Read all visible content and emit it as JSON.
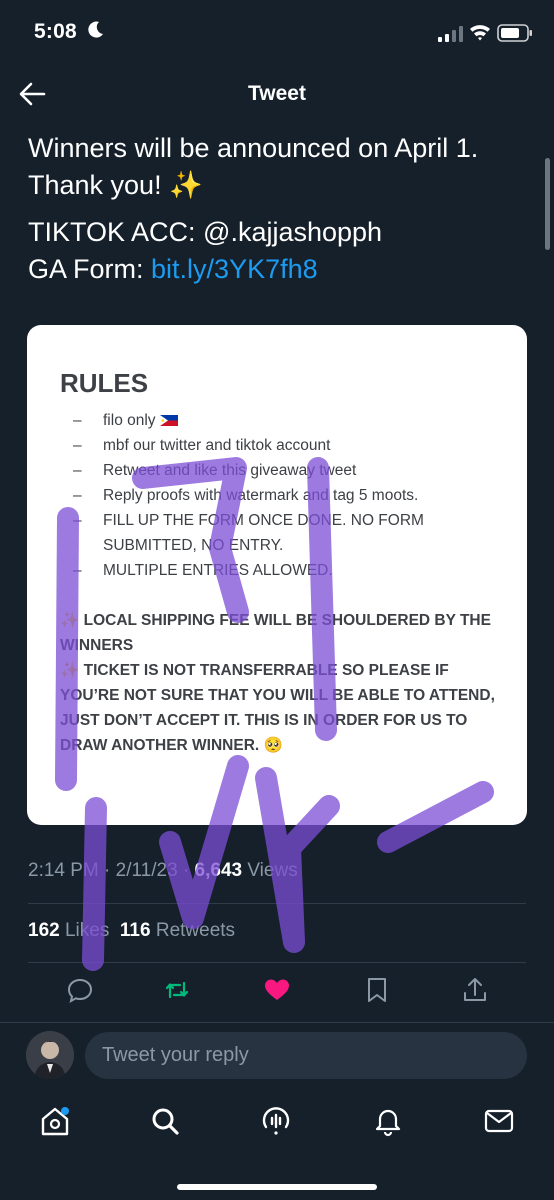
{
  "status_bar": {
    "time": "5:08"
  },
  "header": {
    "title": "Tweet"
  },
  "tweet": {
    "line1": "Winners will be announced on April 1.",
    "line2": "Thank you! ✨",
    "line3": "TIKTOK ACC: @.kajjashopph",
    "form_label": "GA Form: ",
    "form_link": "bit.ly/3YK7fh8"
  },
  "image_card": {
    "title": "RULES",
    "rules": [
      "filo only",
      "mbf our twitter and tiktok account",
      "Retweet and like this giveaway tweet",
      "Reply proofs with watermark and tag 5 moots.",
      "FILL UP THE FORM ONCE DONE. NO FORM SUBMITTED, NO ENTRY.",
      "MULTIPLE ENTRIES ALLOWED."
    ],
    "note1": "LOCAL SHIPPING FEE WILL BE SHOULDERED BY THE WINNERS",
    "note2": "TICKET IS NOT TRANSFERRABLE SO PLEASE IF YOU’RE NOT SURE THAT YOU WILL BE ABLE TO ATTEND, JUST DON’T ACCEPT IT. THIS IS IN ORDER FOR US TO DRAW ANOTHER WINNER. 🥺",
    "sparkle": "✨"
  },
  "meta": {
    "time": "2:14 PM",
    "sep1": " · ",
    "date": "2/11/23",
    "sep2": " · ",
    "views_count": "6,643",
    "views_label": " Views"
  },
  "stats": {
    "likes_count": "162",
    "likes_label": " Likes",
    "retweets_count": "116",
    "retweets_label": " Retweets"
  },
  "actions": [
    "reply-icon",
    "retweet-icon",
    "like-icon",
    "bookmark-icon",
    "share-icon"
  ],
  "reply": {
    "placeholder": "Tweet your reply"
  },
  "tabs": [
    "home-icon",
    "search-icon",
    "spaces-icon",
    "notifications-icon",
    "messages-icon"
  ],
  "colors": {
    "background": "#15202b",
    "link": "#1d9bf0",
    "retweet": "#00ba7c",
    "like": "#f91880",
    "secondary_text": "#8b98a5",
    "scribble": "#7b4dd6"
  }
}
